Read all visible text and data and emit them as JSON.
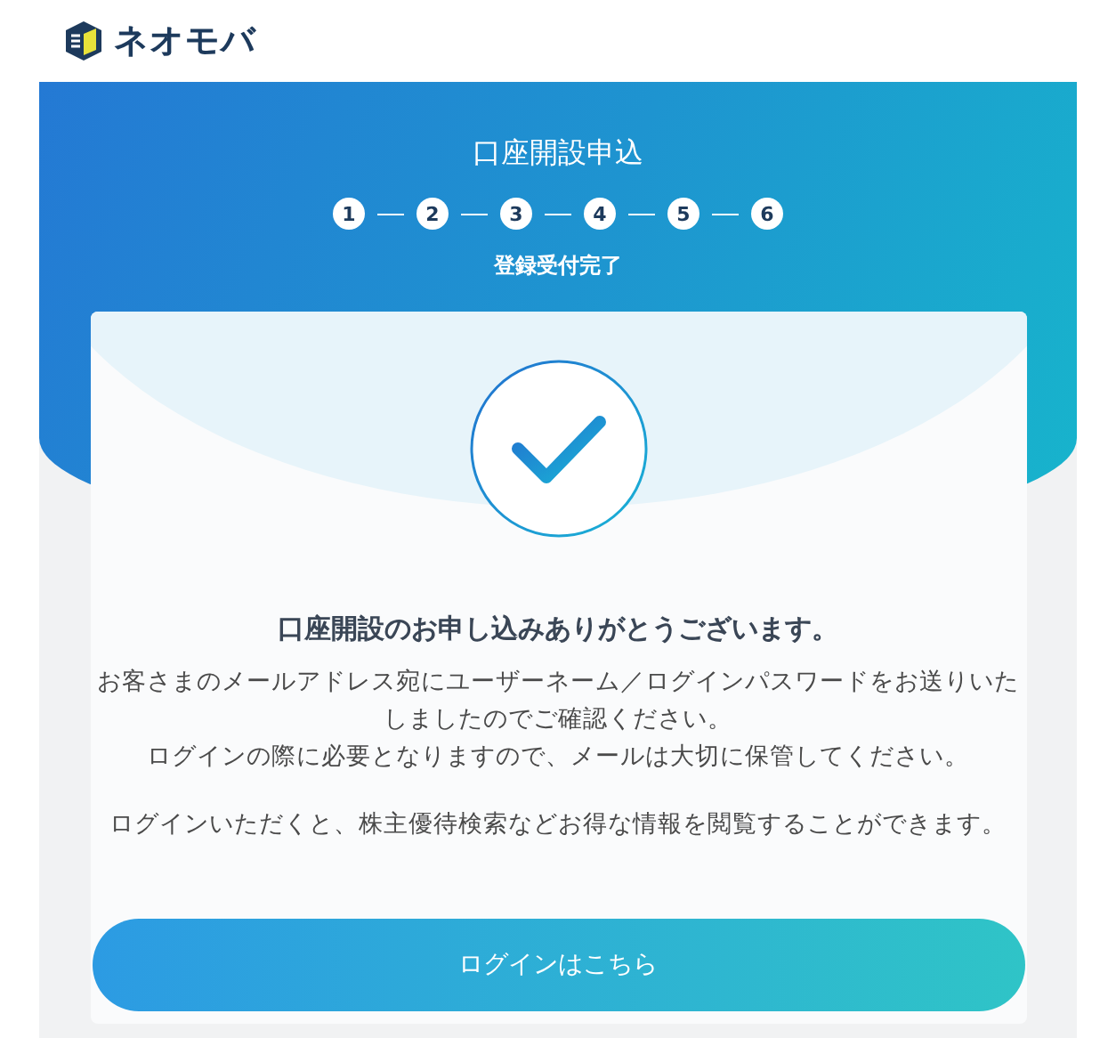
{
  "logo": {
    "text": "ネオモバ"
  },
  "header": {
    "title": "口座開設申込",
    "steps": [
      "1",
      "2",
      "3",
      "4",
      "5",
      "6"
    ],
    "subtitle": "登録受付完了"
  },
  "card": {
    "heading": "口座開設のお申し込みありがとうございます。",
    "paragraphs": [
      "お客さまのメールアドレス宛にユーザーネーム／ログインパスワードをお送りいたしましたのでご確認ください。",
      "ログインの際に必要となりますので、メールは大切に保管してください。",
      "ログインいただくと、株主優待検索などお得な情報を閲覧することができます。"
    ],
    "button": "ログインはこちら"
  }
}
